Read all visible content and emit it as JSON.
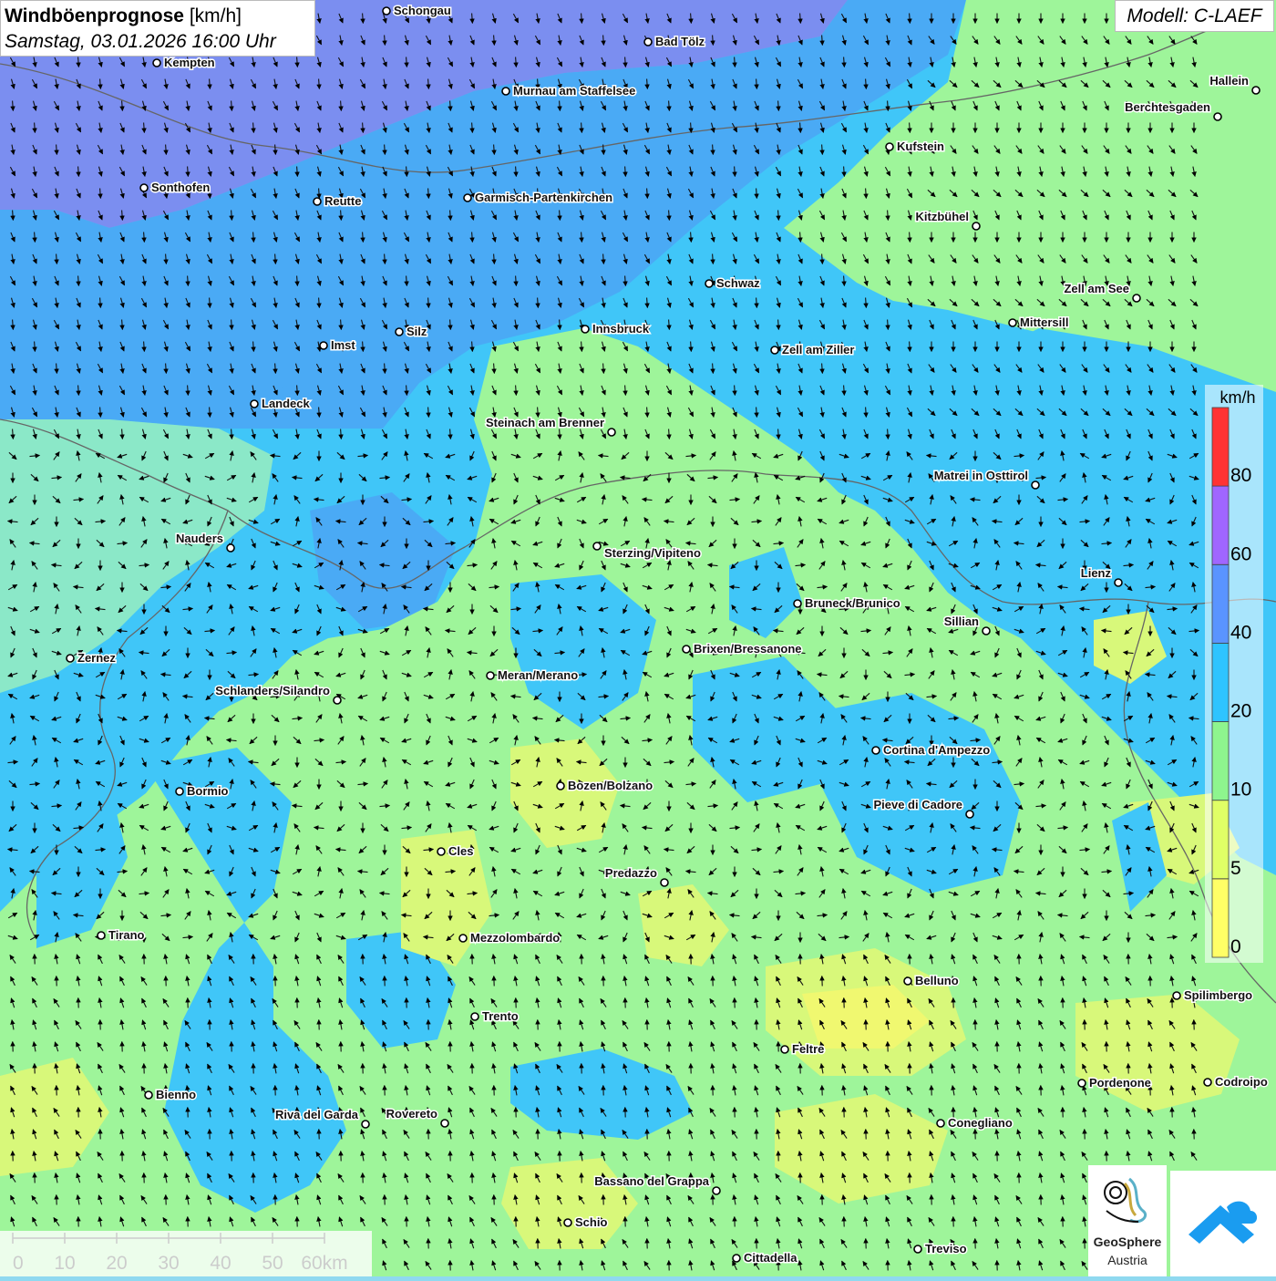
{
  "title": {
    "main": "Windböenprognose",
    "unit": "[km/h]",
    "date": "Samstag, 03.01.2026 16:00 Uhr"
  },
  "model": "Modell: C-LAEF",
  "legend": {
    "unit": "km/h",
    "bands": [
      {
        "label": "0",
        "color": "#ffff66"
      },
      {
        "label": "5",
        "color": "#e0ff66"
      },
      {
        "label": "10",
        "color": "#8ef58e"
      },
      {
        "label": "20",
        "color": "#2ec4ff"
      },
      {
        "label": "40",
        "color": "#5a94ff"
      },
      {
        "label": "60",
        "color": "#a066ff"
      },
      {
        "label": "80",
        "color": "#ff3333"
      }
    ]
  },
  "colors": {
    "very_high": "#7b8ef0",
    "high": "#4aaaf5",
    "medium": "#40c6f8",
    "light": "#8be8c8",
    "low": "#9ef59a",
    "lowest": "#d8f87a",
    "calm": "#f0f870"
  },
  "scale": {
    "labels": [
      "0",
      "10",
      "20",
      "30",
      "40",
      "50",
      "60km"
    ]
  },
  "cities": [
    {
      "name": "Schongau"
    },
    {
      "name": "Bad Tölz"
    },
    {
      "name": "Kempten"
    },
    {
      "name": "Murnau am Staffelsee"
    },
    {
      "name": "Hallein"
    },
    {
      "name": "Berchtesgaden"
    },
    {
      "name": "Kufstein"
    },
    {
      "name": "Sonthofen"
    },
    {
      "name": "Reutte"
    },
    {
      "name": "Garmisch-Partenkirchen"
    },
    {
      "name": "Kitzbühel"
    },
    {
      "name": "Schwaz"
    },
    {
      "name": "Zell am See"
    },
    {
      "name": "Mittersill"
    },
    {
      "name": "Innsbruck"
    },
    {
      "name": "Silz"
    },
    {
      "name": "Imst"
    },
    {
      "name": "Zell am Ziller"
    },
    {
      "name": "Landeck"
    },
    {
      "name": "Steinach am Brenner"
    },
    {
      "name": "Matrei in Osttirol"
    },
    {
      "name": "Nauders"
    },
    {
      "name": "Sterzing/Vipiteno"
    },
    {
      "name": "Lienz"
    },
    {
      "name": "Bruneck/Brunico"
    },
    {
      "name": "Sillian"
    },
    {
      "name": "Zernez"
    },
    {
      "name": "Brixen/Bressanone"
    },
    {
      "name": "Meran/Merano"
    },
    {
      "name": "Schlanders/Silandro"
    },
    {
      "name": "Cortina d'Ampezzo"
    },
    {
      "name": "Bozen/Bolzano"
    },
    {
      "name": "Bormio"
    },
    {
      "name": "Pieve di Cadore"
    },
    {
      "name": "Cles"
    },
    {
      "name": "Predazzo"
    },
    {
      "name": "Tirano"
    },
    {
      "name": "Mezzolombardo"
    },
    {
      "name": "Belluno"
    },
    {
      "name": "Spilimbergo"
    },
    {
      "name": "Trento"
    },
    {
      "name": "Feltre"
    },
    {
      "name": "Pordenone"
    },
    {
      "name": "Codroipo"
    },
    {
      "name": "Bienno"
    },
    {
      "name": "Riva del Garda"
    },
    {
      "name": "Rovereto"
    },
    {
      "name": "Conegliano"
    },
    {
      "name": "Bassano del Grappa"
    },
    {
      "name": "Schio"
    },
    {
      "name": "Treviso"
    },
    {
      "name": "Cittadella"
    }
  ],
  "logos": {
    "geosphere_name": "GeoSphere",
    "geosphere_sub": "Austria"
  }
}
